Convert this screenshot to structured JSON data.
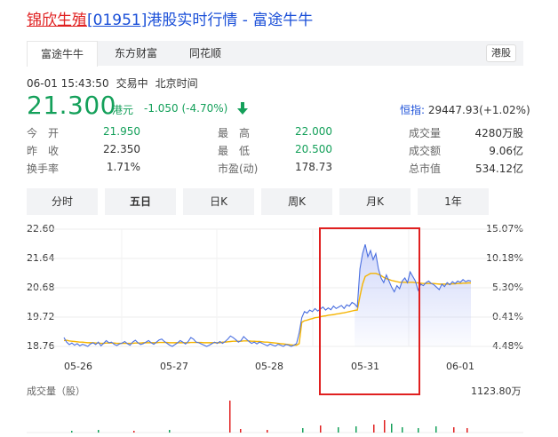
{
  "header": {
    "name": "锦欣生殖",
    "code": "[01951]",
    "suffix": "港股实时行情 - 富途牛牛"
  },
  "tabs": [
    "富途牛牛",
    "东方财富",
    "同花顺"
  ],
  "market_badge": "港股",
  "status": {
    "datetime": "06-01 15:43:50",
    "state": "交易中",
    "tz": "北京时间"
  },
  "quote": {
    "price": "21.300",
    "unit": "港元",
    "change": "-1.050 (-4.70%)"
  },
  "index": {
    "label": "恒指:",
    "value": "29447.93(+1.02%)"
  },
  "stats": {
    "open_label": "今　开",
    "open": "21.950",
    "prev_label": "昨　收",
    "prev": "22.350",
    "turnover_rate_label": "换手率",
    "turnover_rate": "1.71%",
    "high_label": "最　高",
    "high": "22.000",
    "low_label": "最　低",
    "low": "20.500",
    "pe_label": "市盈(动)",
    "pe": "178.73",
    "volume_label": "成交量",
    "volume": "4280万股",
    "amount_label": "成交额",
    "amount": "9.06亿",
    "mcap_label": "总市值",
    "mcap": "534.12亿"
  },
  "ktabs": [
    "分时",
    "五日",
    "日K",
    "周K",
    "月K",
    "1年"
  ],
  "colors": {
    "up": "#e02020",
    "down": "#14a05a",
    "price_line": "#4a6fe0",
    "avg_line": "#f5b400",
    "link": "#1a4fd8"
  },
  "chart_data": {
    "type": "line",
    "left_axis": [
      "22.60",
      "21.64",
      "20.68",
      "19.72",
      "18.76"
    ],
    "right_axis": [
      "15.07%",
      "10.18%",
      "5.30%",
      "0.41%",
      "-4.48%"
    ],
    "ylim": [
      18.76,
      22.6
    ],
    "x_labels": [
      "05-26",
      "05-27",
      "05-28",
      "05-31",
      "06-01"
    ],
    "volume_title": "成交量（股）",
    "volume_max": "1123.80万",
    "series": [
      {
        "values": [
          19.05,
          18.9,
          18.82,
          18.87,
          18.8,
          18.85,
          18.78,
          18.83,
          18.8,
          18.76,
          18.84,
          18.88,
          18.82,
          18.9,
          18.78,
          18.86,
          18.95,
          18.88,
          18.9,
          18.83,
          18.79,
          18.84,
          18.87,
          18.92,
          18.85,
          18.8,
          18.9,
          18.96,
          18.88,
          18.82,
          18.85,
          18.9,
          18.95,
          18.88,
          18.83,
          18.9,
          18.97,
          19.0,
          18.92,
          18.86,
          18.8,
          18.76,
          18.82,
          18.88,
          18.95,
          18.9,
          18.84,
          18.92,
          19.05,
          19.0,
          18.9,
          18.88,
          18.84,
          18.8,
          18.76,
          18.8,
          18.85,
          18.9,
          18.86,
          18.92,
          18.86,
          18.92,
          19.0,
          19.1,
          19.05,
          18.98,
          18.9,
          18.95,
          19.08,
          19.0,
          18.92,
          18.86,
          18.9,
          18.84,
          18.9,
          18.86,
          18.82,
          18.78,
          18.84,
          18.8,
          18.77,
          18.83,
          18.8,
          18.76,
          18.82,
          18.8,
          18.76,
          18.8,
          18.85,
          19.2,
          19.7,
          19.9,
          19.85,
          19.95,
          19.9,
          20.0,
          19.92,
          19.98,
          20.05,
          19.95,
          20.02,
          19.96,
          20.08,
          20.0,
          20.05,
          20.1,
          20.0,
          20.12,
          20.08,
          20.2,
          20.15,
          20.05,
          21.3,
          21.8,
          22.1,
          21.7,
          21.9,
          21.6,
          21.8,
          21.3,
          21.0,
          20.85,
          21.1,
          20.9,
          20.7,
          20.55,
          20.75,
          20.65,
          20.9,
          21.0,
          20.85,
          21.2,
          21.05,
          20.9,
          20.6,
          20.8,
          20.75,
          20.85,
          20.9,
          20.82,
          20.78,
          20.7,
          20.62,
          20.8,
          20.72,
          20.85,
          20.78,
          20.88,
          20.82,
          20.9,
          20.86,
          20.95,
          20.88,
          20.92,
          20.9
        ]
      },
      {
        "values": [
          18.95,
          18.96,
          18.94,
          18.93,
          18.92,
          18.91,
          18.9,
          18.9,
          18.89,
          18.88,
          18.88,
          18.88,
          18.87,
          18.87,
          18.86,
          18.86,
          18.87,
          18.87,
          18.87,
          18.87,
          18.86,
          18.86,
          18.86,
          18.86,
          18.86,
          18.86,
          18.86,
          18.87,
          18.87,
          18.87,
          18.88,
          18.88,
          18.88,
          18.88,
          18.88,
          18.88,
          18.89,
          18.89,
          18.89,
          18.89,
          18.88,
          18.88,
          18.88,
          18.88,
          18.88,
          18.88,
          18.88,
          18.88,
          18.89,
          18.89,
          18.89,
          18.89,
          18.89,
          18.88,
          18.88,
          18.88,
          18.88,
          18.88,
          18.88,
          18.88,
          18.9,
          18.9,
          18.91,
          18.92,
          18.93,
          18.93,
          18.93,
          18.93,
          18.94,
          18.94,
          18.94,
          18.93,
          18.93,
          18.92,
          18.92,
          18.91,
          18.9,
          18.9,
          18.89,
          18.88,
          18.87,
          18.86,
          18.85,
          18.84,
          18.83,
          18.82,
          18.81,
          18.8,
          18.8,
          18.85,
          19.55,
          19.6,
          19.62,
          19.65,
          19.67,
          19.7,
          19.71,
          19.73,
          19.75,
          19.76,
          19.78,
          19.79,
          19.8,
          19.82,
          19.83,
          19.85,
          19.86,
          19.88,
          19.9,
          19.92,
          19.94,
          19.95,
          20.4,
          20.8,
          21.05,
          21.1,
          21.15,
          21.15,
          21.15,
          21.12,
          21.08,
          21.02,
          20.98,
          20.95,
          20.92,
          20.9,
          20.88,
          20.86,
          20.86,
          20.86,
          20.85,
          20.86,
          20.86,
          20.85,
          20.84,
          20.83,
          20.82,
          20.82,
          20.82,
          20.82,
          20.82,
          20.81,
          20.8,
          20.8,
          20.8,
          20.8,
          20.8,
          20.81,
          20.81,
          20.82,
          20.82,
          20.83,
          20.83,
          20.84,
          20.84
        ]
      }
    ]
  }
}
